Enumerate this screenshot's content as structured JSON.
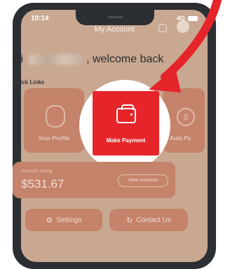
{
  "status_bar": {
    "time": "10:14",
    "signal": "4G"
  },
  "header": {
    "title": "My Account"
  },
  "greeting": {
    "prefix": "Hi",
    "suffix": ", welcome back"
  },
  "quick_links": {
    "label": "Quick Links",
    "tiles": [
      {
        "label": "Your Profile",
        "icon": "profile-shield-icon"
      },
      {
        "label": "Make Payment",
        "icon": "wallet-icon",
        "highlighted": true
      },
      {
        "label": "Auto Pa",
        "icon": "dollar-circle-icon"
      }
    ]
  },
  "account": {
    "amount_label": "Amount owing",
    "amount_value": "$531.67",
    "view_invoices_label": "View Invoices"
  },
  "actions": {
    "settings_label": "Settings",
    "contact_label": "Contact Us"
  },
  "colors": {
    "accent": "#e5252a",
    "tile": "#c4836a",
    "screen_bg": "#c9a891",
    "frame": "#2b2e33"
  }
}
